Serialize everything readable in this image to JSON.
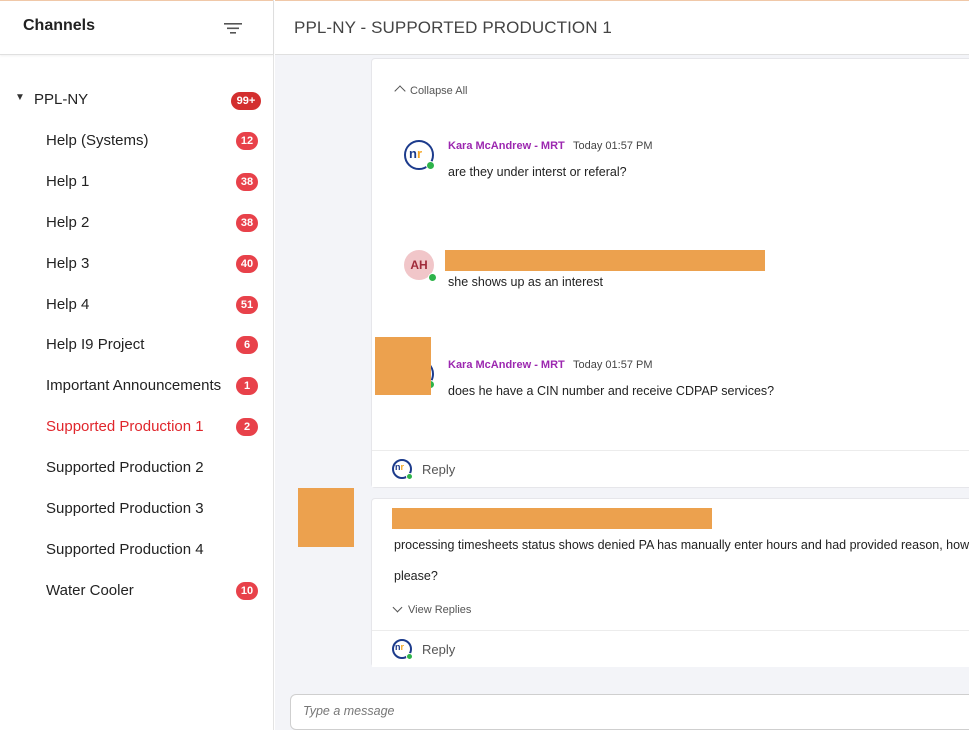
{
  "sidebar": {
    "title": "Channels",
    "group": {
      "label": "PPL-NY",
      "badge": "99+"
    },
    "items": [
      {
        "label": "Help (Systems)",
        "badge": "12"
      },
      {
        "label": "Help 1",
        "badge": "38"
      },
      {
        "label": "Help 2",
        "badge": "38"
      },
      {
        "label": "Help 3",
        "badge": "40"
      },
      {
        "label": "Help 4",
        "badge": "51"
      },
      {
        "label": "Help I9 Project",
        "badge": "6"
      },
      {
        "label": "Important Announcements",
        "badge": "1"
      },
      {
        "label": "Supported Production 1",
        "badge": "2",
        "active": true
      },
      {
        "label": "Supported Production 2",
        "badge": ""
      },
      {
        "label": "Supported Production 3",
        "badge": ""
      },
      {
        "label": "Supported Production 4",
        "badge": ""
      },
      {
        "label": "Water Cooler",
        "badge": "10"
      }
    ]
  },
  "main": {
    "title": "PPL-NY - SUPPORTED PRODUCTION 1",
    "thread": {
      "collapse_label": "Collapse All",
      "messages": [
        {
          "author": "Kara McAndrew - MRT",
          "time": "Today 01:57 PM",
          "text": "are they under interst or referal?"
        },
        {
          "initials": "AH",
          "text": "she shows up as an interest"
        },
        {
          "author": "Kara McAndrew - MRT",
          "time": "Today 01:57 PM",
          "text": "does he have a CIN number and receive CDPAP services?"
        }
      ],
      "reply_label": "Reply"
    },
    "second": {
      "text_line1": "processing timesheets status shows denied PA has manually enter hours and had provided reason, how to",
      "text_line2": "please?",
      "view_replies_label": "View Replies",
      "reply_label": "Reply"
    },
    "composer": {
      "placeholder": "Type a message"
    }
  },
  "colors": {
    "accent_red": "#e0262c",
    "badge": "#e8414a",
    "author": "#9c27b0",
    "online": "#2db34a",
    "redaction": "#eca14e"
  }
}
